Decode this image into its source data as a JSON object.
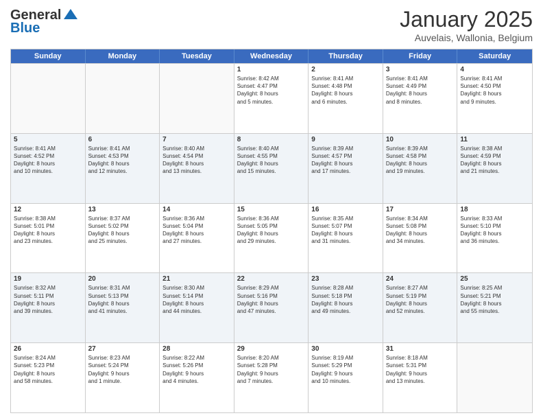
{
  "logo": {
    "general": "General",
    "blue": "Blue"
  },
  "title": "January 2025",
  "subtitle": "Auvelais, Wallonia, Belgium",
  "header_days": [
    "Sunday",
    "Monday",
    "Tuesday",
    "Wednesday",
    "Thursday",
    "Friday",
    "Saturday"
  ],
  "weeks": [
    [
      {
        "day": "",
        "info": ""
      },
      {
        "day": "",
        "info": ""
      },
      {
        "day": "",
        "info": ""
      },
      {
        "day": "1",
        "info": "Sunrise: 8:42 AM\nSunset: 4:47 PM\nDaylight: 8 hours\nand 5 minutes."
      },
      {
        "day": "2",
        "info": "Sunrise: 8:41 AM\nSunset: 4:48 PM\nDaylight: 8 hours\nand 6 minutes."
      },
      {
        "day": "3",
        "info": "Sunrise: 8:41 AM\nSunset: 4:49 PM\nDaylight: 8 hours\nand 8 minutes."
      },
      {
        "day": "4",
        "info": "Sunrise: 8:41 AM\nSunset: 4:50 PM\nDaylight: 8 hours\nand 9 minutes."
      }
    ],
    [
      {
        "day": "5",
        "info": "Sunrise: 8:41 AM\nSunset: 4:52 PM\nDaylight: 8 hours\nand 10 minutes."
      },
      {
        "day": "6",
        "info": "Sunrise: 8:41 AM\nSunset: 4:53 PM\nDaylight: 8 hours\nand 12 minutes."
      },
      {
        "day": "7",
        "info": "Sunrise: 8:40 AM\nSunset: 4:54 PM\nDaylight: 8 hours\nand 13 minutes."
      },
      {
        "day": "8",
        "info": "Sunrise: 8:40 AM\nSunset: 4:55 PM\nDaylight: 8 hours\nand 15 minutes."
      },
      {
        "day": "9",
        "info": "Sunrise: 8:39 AM\nSunset: 4:57 PM\nDaylight: 8 hours\nand 17 minutes."
      },
      {
        "day": "10",
        "info": "Sunrise: 8:39 AM\nSunset: 4:58 PM\nDaylight: 8 hours\nand 19 minutes."
      },
      {
        "day": "11",
        "info": "Sunrise: 8:38 AM\nSunset: 4:59 PM\nDaylight: 8 hours\nand 21 minutes."
      }
    ],
    [
      {
        "day": "12",
        "info": "Sunrise: 8:38 AM\nSunset: 5:01 PM\nDaylight: 8 hours\nand 23 minutes."
      },
      {
        "day": "13",
        "info": "Sunrise: 8:37 AM\nSunset: 5:02 PM\nDaylight: 8 hours\nand 25 minutes."
      },
      {
        "day": "14",
        "info": "Sunrise: 8:36 AM\nSunset: 5:04 PM\nDaylight: 8 hours\nand 27 minutes."
      },
      {
        "day": "15",
        "info": "Sunrise: 8:36 AM\nSunset: 5:05 PM\nDaylight: 8 hours\nand 29 minutes."
      },
      {
        "day": "16",
        "info": "Sunrise: 8:35 AM\nSunset: 5:07 PM\nDaylight: 8 hours\nand 31 minutes."
      },
      {
        "day": "17",
        "info": "Sunrise: 8:34 AM\nSunset: 5:08 PM\nDaylight: 8 hours\nand 34 minutes."
      },
      {
        "day": "18",
        "info": "Sunrise: 8:33 AM\nSunset: 5:10 PM\nDaylight: 8 hours\nand 36 minutes."
      }
    ],
    [
      {
        "day": "19",
        "info": "Sunrise: 8:32 AM\nSunset: 5:11 PM\nDaylight: 8 hours\nand 39 minutes."
      },
      {
        "day": "20",
        "info": "Sunrise: 8:31 AM\nSunset: 5:13 PM\nDaylight: 8 hours\nand 41 minutes."
      },
      {
        "day": "21",
        "info": "Sunrise: 8:30 AM\nSunset: 5:14 PM\nDaylight: 8 hours\nand 44 minutes."
      },
      {
        "day": "22",
        "info": "Sunrise: 8:29 AM\nSunset: 5:16 PM\nDaylight: 8 hours\nand 47 minutes."
      },
      {
        "day": "23",
        "info": "Sunrise: 8:28 AM\nSunset: 5:18 PM\nDaylight: 8 hours\nand 49 minutes."
      },
      {
        "day": "24",
        "info": "Sunrise: 8:27 AM\nSunset: 5:19 PM\nDaylight: 8 hours\nand 52 minutes."
      },
      {
        "day": "25",
        "info": "Sunrise: 8:25 AM\nSunset: 5:21 PM\nDaylight: 8 hours\nand 55 minutes."
      }
    ],
    [
      {
        "day": "26",
        "info": "Sunrise: 8:24 AM\nSunset: 5:23 PM\nDaylight: 8 hours\nand 58 minutes."
      },
      {
        "day": "27",
        "info": "Sunrise: 8:23 AM\nSunset: 5:24 PM\nDaylight: 9 hours\nand 1 minute."
      },
      {
        "day": "28",
        "info": "Sunrise: 8:22 AM\nSunset: 5:26 PM\nDaylight: 9 hours\nand 4 minutes."
      },
      {
        "day": "29",
        "info": "Sunrise: 8:20 AM\nSunset: 5:28 PM\nDaylight: 9 hours\nand 7 minutes."
      },
      {
        "day": "30",
        "info": "Sunrise: 8:19 AM\nSunset: 5:29 PM\nDaylight: 9 hours\nand 10 minutes."
      },
      {
        "day": "31",
        "info": "Sunrise: 8:18 AM\nSunset: 5:31 PM\nDaylight: 9 hours\nand 13 minutes."
      },
      {
        "day": "",
        "info": ""
      }
    ]
  ],
  "alt_rows": [
    1,
    3
  ]
}
